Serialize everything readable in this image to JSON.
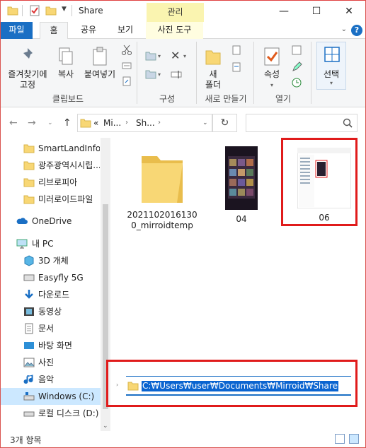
{
  "window": {
    "title": "Share",
    "context_group_label": "관리",
    "controls": {
      "minimize": "—",
      "maximize": "☐",
      "close": "✕"
    }
  },
  "ribbon_tabs": {
    "file": "파일",
    "home": "홈",
    "share": "공유",
    "view": "보기",
    "picture_tools": "사진 도구"
  },
  "ribbon": {
    "clipboard": {
      "pin": "즐겨찾기에\n고정",
      "copy": "복사",
      "paste": "붙여넣기",
      "group": "클립보드"
    },
    "organize": {
      "group": "구성"
    },
    "new": {
      "new_folder": "새\n폴더",
      "group": "새로 만들기"
    },
    "open": {
      "properties": "속성",
      "group": "열기"
    },
    "select": {
      "label": "선택"
    }
  },
  "address_bar": {
    "chevron": "«",
    "seg1": "Mi...",
    "seg2": "Sh...",
    "refresh": "↻"
  },
  "nav_pane": {
    "items": [
      {
        "label": "SmartLandInfo",
        "icon": "folder-icon"
      },
      {
        "label": "광주광역시시립...",
        "icon": "folder-icon"
      },
      {
        "label": "리브로피아",
        "icon": "folder-icon"
      },
      {
        "label": "미러로이드파일",
        "icon": "folder-icon"
      },
      {
        "label": "OneDrive",
        "icon": "cloud-icon"
      },
      {
        "label": "내 PC",
        "icon": "computer-icon"
      },
      {
        "label": "3D 개체",
        "icon": "cube-icon"
      },
      {
        "label": "Easyfly 5G",
        "icon": "drive-icon"
      },
      {
        "label": "다운로드",
        "icon": "download-icon"
      },
      {
        "label": "동영상",
        "icon": "video-icon"
      },
      {
        "label": "문서",
        "icon": "document-icon"
      },
      {
        "label": "바탕 화면",
        "icon": "desktop-icon"
      },
      {
        "label": "사진",
        "icon": "pictures-icon"
      },
      {
        "label": "음악",
        "icon": "music-icon"
      },
      {
        "label": "Windows (C:)",
        "icon": "windows-drive-icon"
      },
      {
        "label": "로컬 디스크 (D:)",
        "icon": "local-disk-icon"
      }
    ]
  },
  "files": [
    {
      "name": "2021102016130\n0_mirroidtemp",
      "type": "folder"
    },
    {
      "name": "04",
      "type": "image"
    },
    {
      "name": "06",
      "type": "image"
    }
  ],
  "path_overlay": {
    "path": "C:₩Users₩user₩Documents₩Mirroid₩Share"
  },
  "status_bar": {
    "item_count": "3개 항목"
  },
  "colors": {
    "accent": "#1a6fc4",
    "highlight_box": "#e01b1b",
    "folder": "#f8d775",
    "selection": "#cce8ff"
  }
}
